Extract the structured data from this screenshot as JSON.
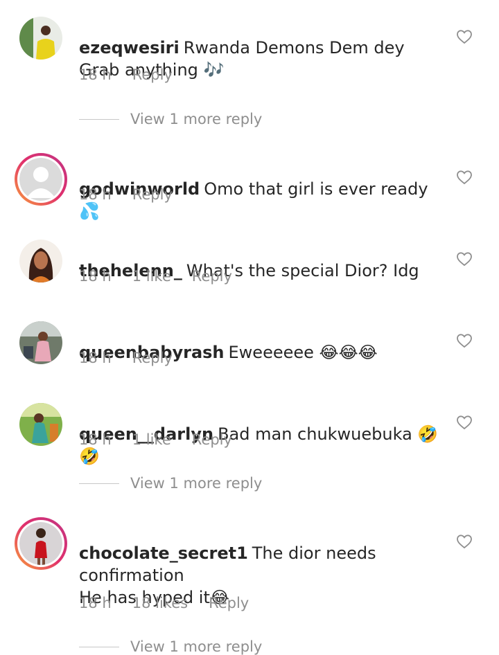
{
  "comments": [
    {
      "username": "ezeqwesiri",
      "text": "Rwanda Demons Dem dey Grab anything 🎶",
      "time": "18 h",
      "likes": "",
      "reply": "Reply",
      "view_more": "View 1 more reply"
    },
    {
      "username": "godwinworld",
      "text": "Omo that girl is ever ready 💦",
      "time": "18 h",
      "likes": "",
      "reply": "Reply"
    },
    {
      "username": "thehelenn_",
      "text": "What's the special Dior? Idg",
      "time": "18 h",
      "likes": "1 like",
      "reply": "Reply"
    },
    {
      "username": "queenbabyrash",
      "text": "Eweeeeee 😂😂😂",
      "time": "18 h",
      "likes": "",
      "reply": "Reply"
    },
    {
      "username": "queen__darlyn",
      "text": "Bad man chukwuebuka 🤣🤣",
      "time": "18 h",
      "likes": "1 like",
      "reply": "Reply",
      "view_more": "View 1 more reply"
    },
    {
      "username": "chocolate_secret1",
      "text": "The dior needs confirmation\nHe has hyped it😂",
      "time": "18 h",
      "likes": "18 likes",
      "reply": "Reply",
      "view_more": "View 1 more reply"
    }
  ],
  "colors": {
    "text": "#262626",
    "meta": "#8e8e8e",
    "story_ring_start": "#f9a13a",
    "story_ring_end": "#c13584"
  }
}
